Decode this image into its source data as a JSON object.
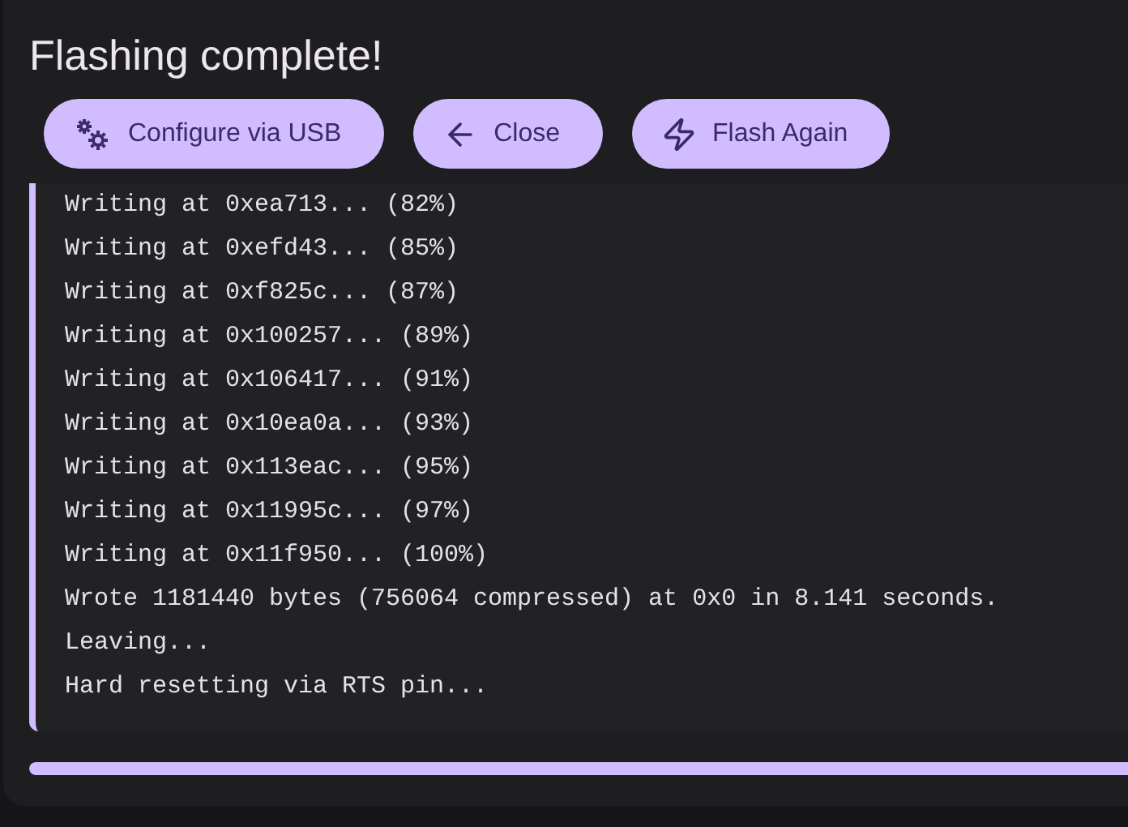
{
  "dialog": {
    "title": "Flashing complete!",
    "buttons": [
      {
        "kind": "gears",
        "label": "Configure via USB"
      },
      {
        "kind": "back",
        "label": "Close"
      },
      {
        "kind": "flash",
        "label": "Flash Again"
      }
    ],
    "log": [
      "Writing at 0xea713... (82%)",
      "Writing at 0xefd43... (85%)",
      "Writing at 0xf825c... (87%)",
      "Writing at 0x100257... (89%)",
      "Writing at 0x106417... (91%)",
      "Writing at 0x10ea0a... (93%)",
      "Writing at 0x113eac... (95%)",
      "Writing at 0x11995c... (97%)",
      "Writing at 0x11f950... (100%)",
      "Wrote 1181440 bytes (756064 compressed) at 0x0 in 8.141 seconds.",
      "Leaving...",
      "Hard resetting via RTS pin..."
    ],
    "progress": {
      "level": 1
    }
  }
}
